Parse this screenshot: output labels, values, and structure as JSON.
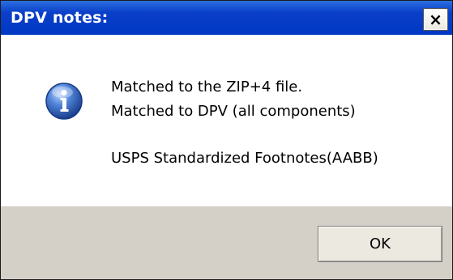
{
  "dialog": {
    "title": "DPV notes:",
    "close_label": "×",
    "icon": "info-icon",
    "messages": [
      "Matched to the ZIP+4 file.",
      "Matched to DPV (all components)",
      "USPS Standardized Footnotes(AABB)"
    ],
    "ok_label": "OK"
  },
  "colors": {
    "titlebar": "#0038c4",
    "footer": "#d4d0c8",
    "icon_blue": "#2c5fb8"
  }
}
